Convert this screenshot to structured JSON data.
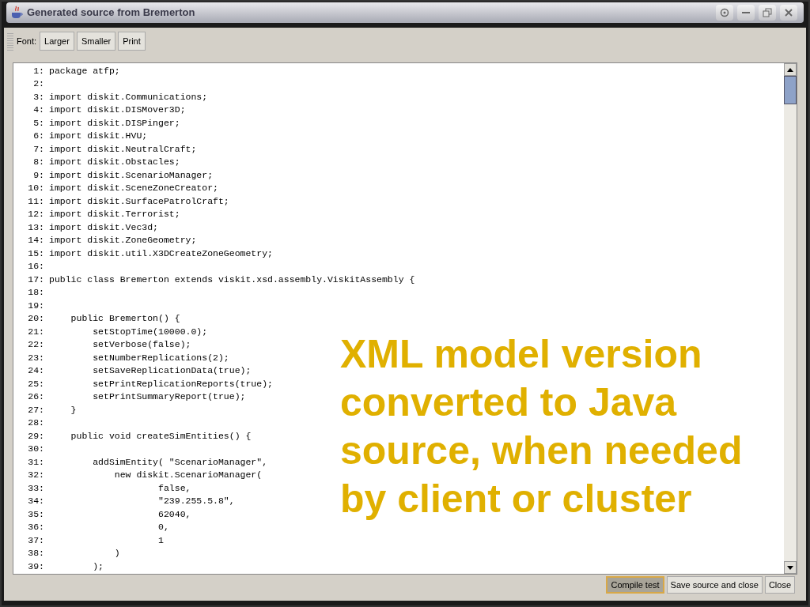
{
  "window": {
    "title": "Generated source from Bremerton"
  },
  "toolbar": {
    "label": "Font:",
    "buttons": [
      "Larger",
      "Smaller",
      "Print"
    ]
  },
  "code_lines": [
    {
      "number": "1:",
      "text": "package atfp;"
    },
    {
      "number": "2:"
    },
    {
      "number": "3:",
      "text": "import diskit.Communications;"
    },
    {
      "number": "4:",
      "text": "import diskit.DISMover3D;"
    },
    {
      "number": "5:",
      "text": "import diskit.DISPinger;"
    },
    {
      "number": "6:",
      "text": "import diskit.HVU;"
    },
    {
      "number": "7:",
      "text": "import diskit.NeutralCraft;"
    },
    {
      "number": "8:",
      "text": "import diskit.Obstacles;"
    },
    {
      "number": "9:",
      "text": "import diskit.ScenarioManager;"
    },
    {
      "number": "10:",
      "text": "import diskit.SceneZoneCreator;"
    },
    {
      "number": "11:",
      "text": "import diskit.SurfacePatrolCraft;"
    },
    {
      "number": "12:",
      "text": "import diskit.Terrorist;"
    },
    {
      "number": "13:",
      "text": "import diskit.Vec3d;"
    },
    {
      "number": "14:",
      "text": "import diskit.ZoneGeometry;"
    },
    {
      "number": "15:",
      "text": "import diskit.util.X3DCreateZoneGeometry;"
    },
    {
      "number": "16:"
    },
    {
      "number": "17:",
      "text": "public class Bremerton extends viskit.xsd.assembly.ViskitAssembly {"
    },
    {
      "number": "18:"
    },
    {
      "number": "19:"
    },
    {
      "number": "20:",
      "text": "    public Bremerton() {"
    },
    {
      "number": "21:",
      "text": "        setStopTime(10000.0);"
    },
    {
      "number": "22:",
      "text": "        setVerbose(false);"
    },
    {
      "number": "23:",
      "text": "        setNumberReplications(2);"
    },
    {
      "number": "24:",
      "text": "        setSaveReplicationData(true);"
    },
    {
      "number": "25:",
      "text": "        setPrintReplicationReports(true);"
    },
    {
      "number": "26:",
      "text": "        setPrintSummaryReport(true);"
    },
    {
      "number": "27:",
      "text": "    }"
    },
    {
      "number": "28:"
    },
    {
      "number": "29:",
      "text": "    public void createSimEntities() {"
    },
    {
      "number": "30:"
    },
    {
      "number": "31:",
      "text": "        addSimEntity( \"ScenarioManager\","
    },
    {
      "number": "32:",
      "text": "            new diskit.ScenarioManager("
    },
    {
      "number": "33:",
      "text": "                    false,"
    },
    {
      "number": "34:",
      "text": "                    \"239.255.5.8\","
    },
    {
      "number": "35:",
      "text": "                    62040,"
    },
    {
      "number": "36:",
      "text": "                    0,"
    },
    {
      "number": "37:",
      "text": "                    1"
    },
    {
      "number": "38:",
      "text": "            )"
    },
    {
      "number": "39:",
      "text": "        );"
    }
  ],
  "footer_buttons": [
    {
      "label": "Compile test",
      "focused": true
    },
    {
      "label": "Save source and close",
      "focused": false
    },
    {
      "label": "Close",
      "focused": false
    }
  ],
  "annotation": "XML model version converted to Java source, when needed by client or cluster"
}
